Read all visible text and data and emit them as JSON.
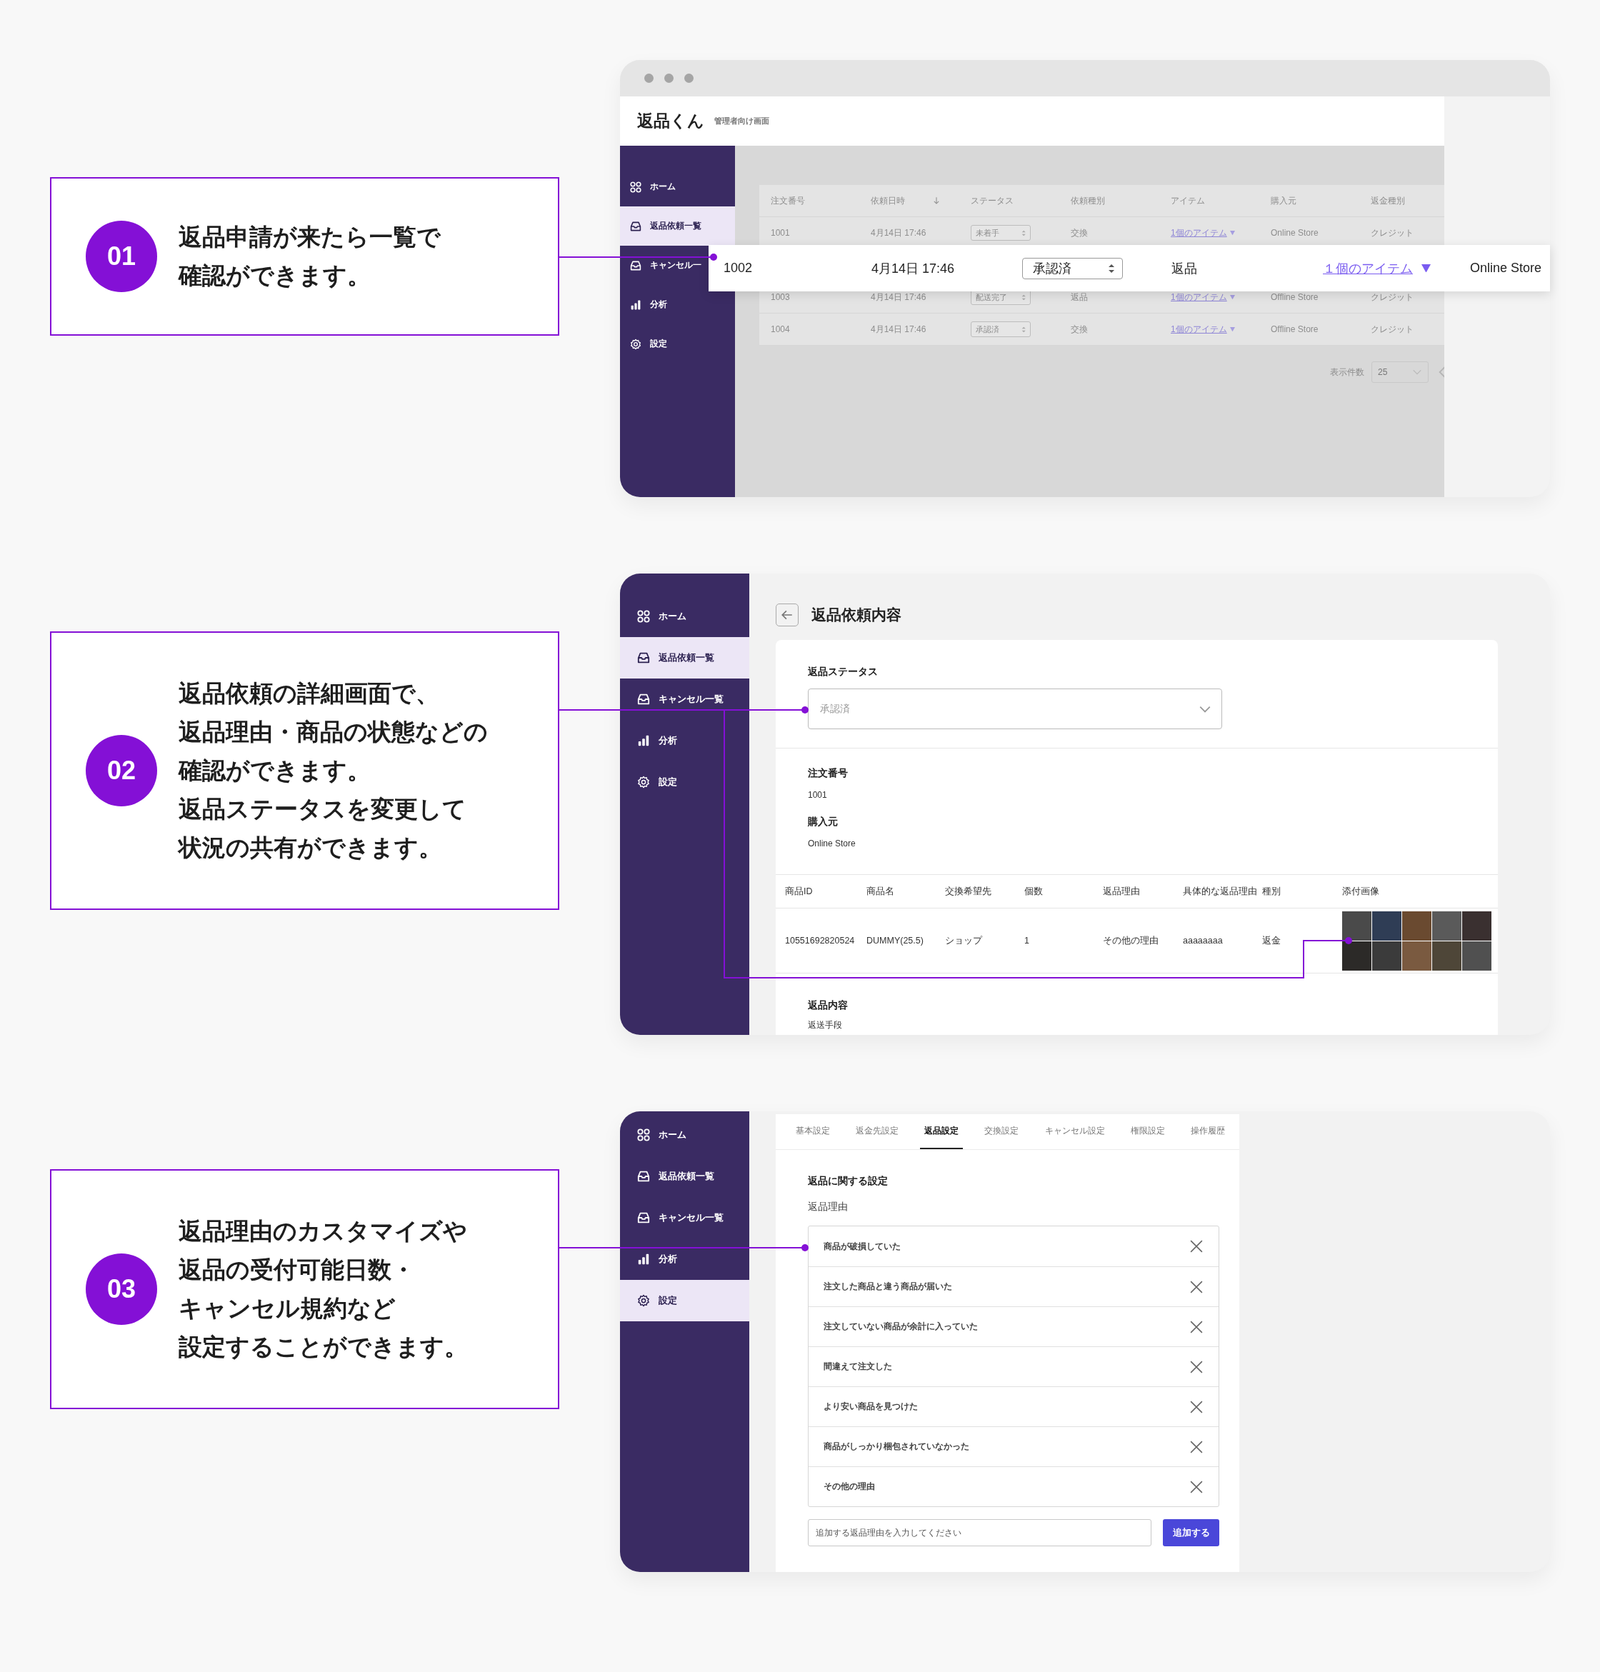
{
  "callouts": [
    {
      "number": "01",
      "lines": [
        "返品申請が来たら一覧で",
        "確認ができます。"
      ]
    },
    {
      "number": "02",
      "lines": [
        "返品依頼の詳細画面で、",
        "返品理由・商品の状態などの",
        "確認ができます。",
        "返品ステータスを変更して",
        "状況の共有ができます。"
      ]
    },
    {
      "number": "03",
      "lines": [
        "返品理由のカスタマイズや",
        "返品の受付可能日数・",
        "キャンセル規約など",
        "設定することができます。"
      ]
    }
  ],
  "list_screen": {
    "logo": "返品くん",
    "subtitle": "管理者向け画面",
    "sidebar": [
      {
        "label": "ホーム",
        "selected": false
      },
      {
        "label": "返品依頼一覧",
        "selected": true
      },
      {
        "label": "キャンセル一",
        "selected": false
      },
      {
        "label": "分析",
        "selected": false
      },
      {
        "label": "設定",
        "selected": false
      }
    ],
    "table": {
      "columns": [
        "注文番号",
        "依頼日時",
        "ステータス",
        "依頼種別",
        "アイテム",
        "購入元",
        "返金種別"
      ],
      "rows": [
        {
          "order": "1001",
          "date": "4月14日 17:46",
          "status": "未着手",
          "type": "交換",
          "items": "1個のアイテム",
          "store": "Online Store",
          "refund": "クレジット"
        },
        {
          "order": "1003",
          "date": "4月14日 17:46",
          "status": "配送完了",
          "type": "返品",
          "items": "1個のアイテム",
          "store": "Offline Store",
          "refund": "クレジット"
        },
        {
          "order": "1004",
          "date": "4月14日 17:46",
          "status": "承認済",
          "type": "交換",
          "items": "1個のアイテム",
          "store": "Offline Store",
          "refund": "クレジット"
        }
      ]
    },
    "zoomed_row": {
      "order": "1002",
      "date": "4月14日 17:46",
      "status": "承認済",
      "type": "返品",
      "items": "１個のアイテム",
      "store": "Online Store"
    },
    "page_size": {
      "label": "表示件数",
      "value": "25"
    }
  },
  "detail_screen": {
    "title": "返品依頼内容",
    "sidebar": [
      {
        "label": "ホーム",
        "selected": false
      },
      {
        "label": "返品依頼一覧",
        "selected": true
      },
      {
        "label": "キャンセル一覧",
        "selected": false
      },
      {
        "label": "分析",
        "selected": false
      },
      {
        "label": "設定",
        "selected": false
      }
    ],
    "status_label": "返品ステータス",
    "status_placeholder": "承認済",
    "fields": [
      {
        "label": "注文番号",
        "value": "1001"
      },
      {
        "label": "購入元",
        "value": "Online Store"
      }
    ],
    "items_table": {
      "columns": [
        "商品ID",
        "商品名",
        "交換希望先",
        "個数",
        "返品理由",
        "具体的な返品理由",
        "種別",
        "添付画像"
      ],
      "rows": [
        [
          "10551692820524",
          "DUMMY(25.5)",
          "ショップ",
          "1",
          "その他の理由",
          "aaaaaaaa",
          "返金"
        ]
      ]
    },
    "content_label": "返品内容",
    "content_sublabel": "返送手段"
  },
  "settings_screen": {
    "sidebar": [
      {
        "label": "ホーム",
        "selected": false
      },
      {
        "label": "返品依頼一覧",
        "selected": false
      },
      {
        "label": "キャンセル一覧",
        "selected": false
      },
      {
        "label": "分析",
        "selected": false
      },
      {
        "label": "設定",
        "selected": true
      }
    ],
    "tabs": [
      {
        "label": "基本設定",
        "selected": false
      },
      {
        "label": "返金先設定",
        "selected": false
      },
      {
        "label": "返品設定",
        "selected": true
      },
      {
        "label": "交換設定",
        "selected": false
      },
      {
        "label": "キャンセル設定",
        "selected": false
      },
      {
        "label": "権限設定",
        "selected": false
      },
      {
        "label": "操作履歴",
        "selected": false
      }
    ],
    "section_title": "返品に関する設定",
    "list_label": "返品理由",
    "reasons": [
      "商品が破損していた",
      "注文した商品と違う商品が届いた",
      "注文していない商品が余計に入っていた",
      "間違えて注文した",
      "より安い商品を見つけた",
      "商品がしっかり梱包されていなかった",
      "その他の理由"
    ],
    "input_placeholder": "追加する返品理由を入力してください",
    "add_button": "追加する"
  }
}
